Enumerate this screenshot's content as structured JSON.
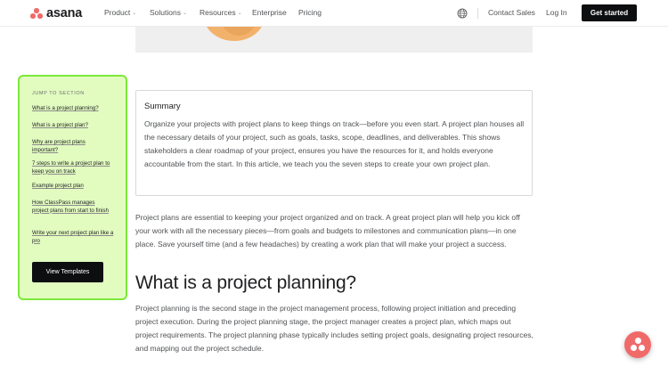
{
  "brand": {
    "name": "asana",
    "color": "#f06a6a"
  },
  "nav": {
    "items": [
      {
        "label": "Product",
        "dropdown": true
      },
      {
        "label": "Solutions",
        "dropdown": true
      },
      {
        "label": "Resources",
        "dropdown": true
      },
      {
        "label": "Enterprise",
        "dropdown": false
      },
      {
        "label": "Pricing",
        "dropdown": false
      }
    ],
    "globe_icon": "globe-icon",
    "contact_sales": "Contact Sales",
    "log_in": "Log In",
    "get_started": "Get started"
  },
  "sidebar": {
    "title": "JUMP TO SECTION",
    "links": [
      "What is a project planning?",
      "What is a project plan?",
      "Why are project plans important?",
      "7 steps to write a project plan to keep you on track",
      "Example project plan",
      "How ClassPass manages project plans from start to finish",
      "Write your next project plan like a pro"
    ],
    "button": "View Templates",
    "bg_color": "#e2fcc0",
    "border_color": "#7ce83b"
  },
  "summary": {
    "title": "Summary",
    "body": "Organize your projects with project plans to keep things on track—before you even start. A project plan houses all the necessary details of your project, such as goals, tasks, scope, deadlines, and deliverables. This shows stakeholders a clear roadmap of your project, ensures you have the resources for it, and holds everyone accountable from the start. In this article, we teach you the seven steps to create your own project plan."
  },
  "intro": "Project plans are essential to keeping your project organized and on track. A great project plan will help you kick off your work with all the necessary pieces—from goals and budgets to milestones and communication plans—in one place. Save yourself time (and a few headaches) by creating a work plan that will make your project a success.",
  "section": {
    "heading": "What is a project planning?",
    "body": "Project planning is the second stage in the project management process, following project initiation and preceding project execution. During the project planning stage, the project manager creates a project plan, which maps out project requirements. The project planning phase typically includes setting project goals, designating project resources, and mapping out the project schedule."
  },
  "chat_button_icon": "asana-chat-icon"
}
